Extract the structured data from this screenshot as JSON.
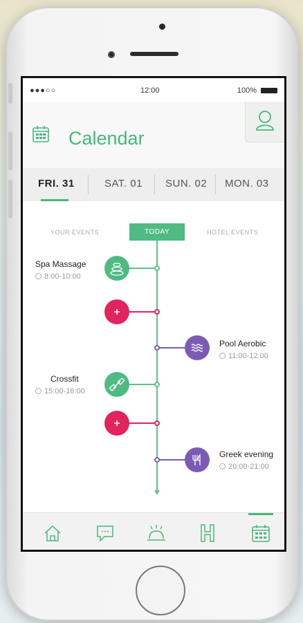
{
  "status_bar": {
    "signal": "●●●○○",
    "time": "12:00",
    "battery": "100%"
  },
  "header": {
    "title": "Calendar",
    "calendar_icon": "calendar-icon",
    "profile_icon": "user-icon"
  },
  "date_tabs": [
    {
      "label": "FRI. 31",
      "active": true
    },
    {
      "label": "SAT. 01",
      "active": false
    },
    {
      "label": "SUN. 02",
      "active": false
    },
    {
      "label": "MON. 03",
      "active": false
    }
  ],
  "timeline": {
    "your_events_label": "YOUR EVENTS",
    "today_label": "TODAY",
    "hotel_events_label": "HOTEL EVENTS",
    "events": [
      {
        "title": "Spa Massage",
        "time": "8:00-10:00",
        "side": "left",
        "icon": "spa-stones-icon",
        "color": "#4fbb83"
      },
      {
        "title": "",
        "time": "",
        "side": "left",
        "icon": "add-icon",
        "color": "#e0245e"
      },
      {
        "title": "Pool Aerobic",
        "time": "11:00-12:00",
        "side": "right",
        "icon": "water-waves-icon",
        "color": "#7b5bb3"
      },
      {
        "title": "Crossfit",
        "time": "15:00-16:00",
        "side": "left",
        "icon": "dumbbell-icon",
        "color": "#4fbb83"
      },
      {
        "title": "",
        "time": "",
        "side": "left",
        "icon": "add-icon",
        "color": "#e0245e"
      },
      {
        "title": "Greek evening",
        "time": "20:00-21:00",
        "side": "right",
        "icon": "fork-knife-icon",
        "color": "#7b5bb3"
      }
    ]
  },
  "bottom_nav": [
    {
      "icon": "home-icon",
      "active": false
    },
    {
      "icon": "chat-icon",
      "active": false
    },
    {
      "icon": "room-service-icon",
      "active": false
    },
    {
      "icon": "hotel-icon",
      "active": false
    },
    {
      "icon": "calendar-icon",
      "active": true
    }
  ],
  "colors": {
    "accent": "#46b77a",
    "add": "#e0245e",
    "hotel": "#7b5bb3"
  }
}
